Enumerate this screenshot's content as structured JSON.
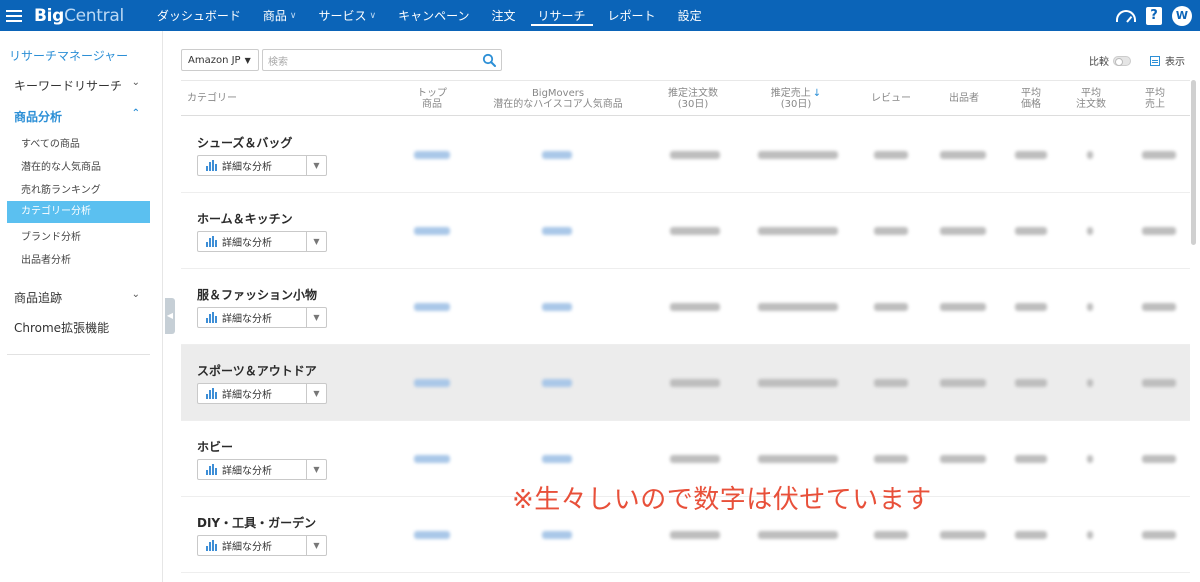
{
  "app": {
    "logo_bold": "Big",
    "logo_rest": "Central"
  },
  "nav": {
    "items": [
      {
        "label": "ダッシュボード",
        "caret": false,
        "active": false
      },
      {
        "label": "商品",
        "caret": true,
        "active": false
      },
      {
        "label": "サービス",
        "caret": true,
        "active": false
      },
      {
        "label": "キャンペーン",
        "caret": false,
        "active": false
      },
      {
        "label": "注文",
        "caret": false,
        "active": false
      },
      {
        "label": "リサーチ",
        "caret": false,
        "active": true
      },
      {
        "label": "レポート",
        "caret": false,
        "active": false
      },
      {
        "label": "設定",
        "caret": false,
        "active": false
      }
    ],
    "help_label": "?",
    "avatar_initial": "W"
  },
  "sidebar": {
    "title": "リサーチマネージャー",
    "keyword_research": "キーワードリサーチ",
    "product_analysis": "商品分析",
    "sub_items": [
      {
        "label": "すべての商品",
        "active": false
      },
      {
        "label": "潜在的な人気商品",
        "active": false
      },
      {
        "label": "売れ筋ランキング",
        "active": false
      },
      {
        "label": "カテゴリー分析",
        "active": true
      },
      {
        "label": "ブランド分析",
        "active": false
      },
      {
        "label": "出品者分析",
        "active": false
      }
    ],
    "product_tracking": "商品追跡",
    "chrome_extension": "Chrome拡張機能"
  },
  "toolbar": {
    "market": "Amazon JP",
    "search_placeholder": "検索",
    "compare_label": "比較",
    "display_label": "表示"
  },
  "table": {
    "headers": {
      "category": "カテゴリー",
      "top_products_1": "トップ",
      "top_products_2": "商品",
      "bigmovers_1": "BigMovers",
      "bigmovers_2": "潜在的なハイスコア人気商品",
      "est_orders_1": "推定注文数",
      "est_orders_2": "(30日)",
      "est_sales_1": "推定売上",
      "est_sales_2": "(30日)",
      "reviews": "レビュー",
      "sellers": "出品者",
      "avg_price_1": "平均",
      "avg_price_2": "価格",
      "avg_orders_1": "平均",
      "avg_orders_2": "注文数",
      "avg_sales_1": "平均",
      "avg_sales_2": "売上"
    },
    "detail_button_label": "詳細な分析",
    "rows": [
      {
        "name": "シューズ＆バッグ"
      },
      {
        "name": "ホーム＆キッチン"
      },
      {
        "name": "服＆ファッション小物"
      },
      {
        "name": "スポーツ＆アウトドア",
        "hover": true
      },
      {
        "name": "ホビー"
      },
      {
        "name": "DIY・工具・ガーデン"
      }
    ]
  },
  "notice": "※生々しいので数字は伏せています",
  "colors": {
    "brand": "#0b64b8",
    "accent": "#2c8fd6",
    "active_item": "#5bc0f0",
    "notice": "#e8503a"
  }
}
